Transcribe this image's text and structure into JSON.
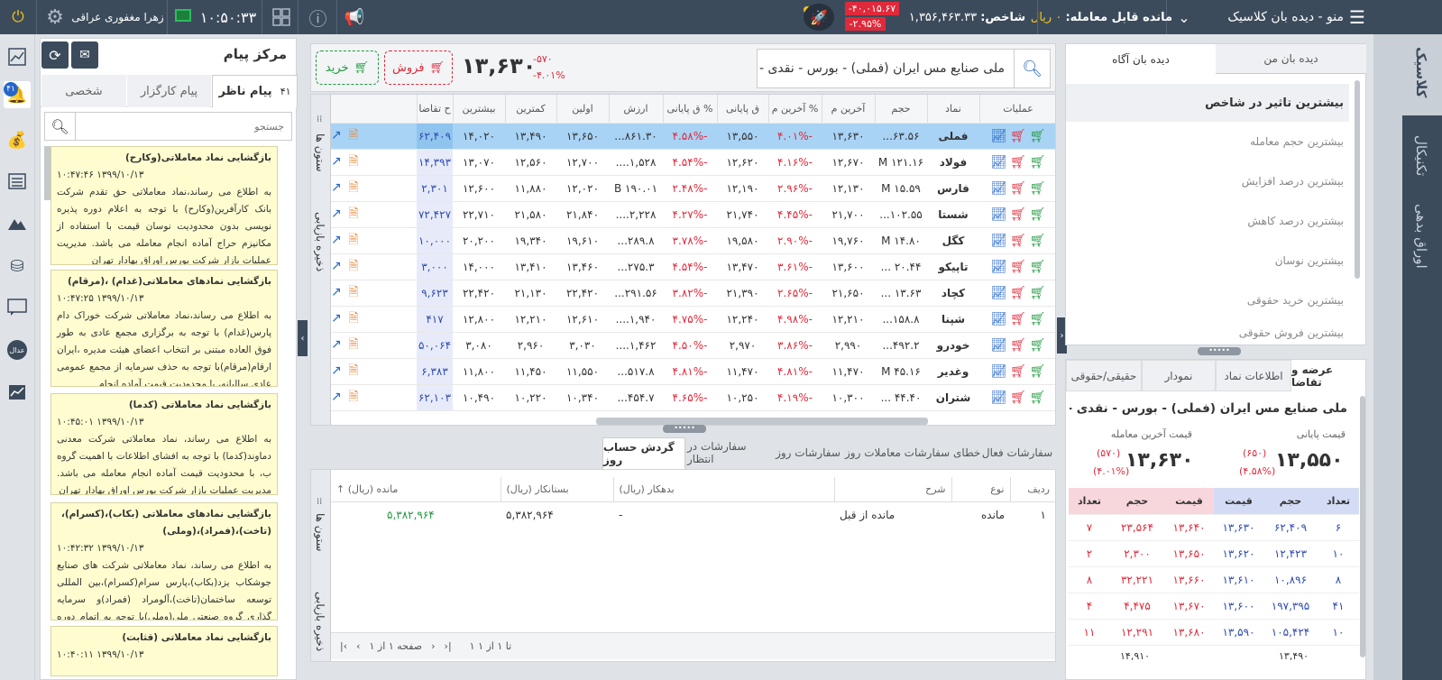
{
  "topbar": {
    "menu_label": "منو - دیده بان کلاسیک",
    "balance_label": "مانده قابل معامله:",
    "balance_value": "۰ ریال",
    "index_label": "شاخص:",
    "index_value": "۱,۳۵۶,۴۶۳.۳۳",
    "index_change": "-۴۰,۰۱۵.۶۷",
    "index_percent": "-۲.۹۵%",
    "clock": "۱۰:۵۰:۳۳",
    "user_name": "زهرا مغفوری عراقی"
  },
  "right_vertical_tabs": [
    "کلاسیک",
    "تکنیکال",
    "اوراق بدهی"
  ],
  "message_center": {
    "title": "مرکز پیام",
    "tabs": [
      "پیام ناظر",
      "پیام کارگزار",
      "شخصی"
    ],
    "badge": "۴۱",
    "search_placeholder": "جستجو",
    "messages": [
      {
        "title": "بازگشایی نماد معاملاتی(وکارح)",
        "time": "۱۳۹۹/۱۰/۱۳ ۱۰:۴۷:۴۶",
        "body": "به اطلاع می رساند،نماد معاملاتی حق تقدم شرکت بانک کارآفرین(وکارح) با توجه به اعلام دوره پذیره نویسی بدون محدودیت نوسان قیمت با استفاده از مکانیزم حراج آماده انجام معامله می باشد. مدیریت عملیات بازار شرکت بورس اوراق بهادار تهران"
      },
      {
        "title": "بازگشایی نمادهای معاملاتی(غدام) ،(مرقام)",
        "time": "۱۳۹۹/۱۰/۱۳ ۱۰:۴۷:۲۵",
        "body": "به اطلاع می رساند،نماد معاملاتی شرکت خوراک دام پارس(غدام) با توجه به برگزاری مجمع عادی به طور فوق العاده مبتنی بر انتخاب اعضای هیئت مدیره ،ایران ارقام(مرقام)با توجه به حذف سرمایه از مجمع عمومی عادی سالیانه، با محدودیت قیمت آماده انجام"
      },
      {
        "title": "بازگشایی نماد معاملاتی (کدما)",
        "time": "۱۳۹۹/۱۰/۱۳ ۱۰:۴۵:۰۱",
        "body": "به اطلاع می رساند، نماد معاملاتی شرکت معدنی دماوند(کدما) با توجه به افشای اطلاعات با اهمیت گروه ب، با محدودیت قیمت آماده انجام معامله می باشد. مدیریت عملیات بازار شرکت بورس اوراق بهادار تهران"
      },
      {
        "title": "بازگشایی نمادهای معاملاتی (بکاب)،(کسرام)،(تاخت)،(فمراد)،(وملی)",
        "time": "۱۳۹۹/۱۰/۱۳ ۱۰:۴۲:۳۲",
        "body": "به اطلاع می رساند، نماد معاملاتی شرکت های صنایع جوشکاب یزد(بکاب)،پارس سرام(کسرام)،بین المللی توسعه ساختمان(تاخت)،آلومراد (فمراد)و سرمایه گذاری گروه صنعتی ملی(وملی)با توجه به اتمام دوره توقف مربوط به"
      },
      {
        "title": "بازگشایی نماد معاملاتی (قثابت)",
        "time": "۱۳۹۹/۱۰/۱۳ ۱۰:۴۰:۱۱",
        "body": ""
      }
    ]
  },
  "order_bar": {
    "buy_label": "خرید",
    "sell_label": "فروش",
    "price": "۱۳,۶۳۰",
    "change": "-۵۷۰",
    "change_percent": "-۴.۰۱%",
    "symbol_search": "ملی صنایع مس ایران (فملی) - بورس - نقدی - مجاز"
  },
  "watch": {
    "side_columns": "ستون ها",
    "side_save": "ذخیره بازیابی",
    "headers": [
      "عملیات",
      "نماد",
      "حجم",
      "آخرین م",
      "% آخرین م",
      "ق پایانی",
      "% ق پایانی",
      "ارزش",
      "اولین",
      "کمترین",
      "بیشترین",
      "ح تقاضا"
    ],
    "rows": [
      {
        "s": "فملی",
        "v": "۶۳.۵۶...",
        "l": "۱۳,۶۳۰",
        "lp": "-۴.۰۱%",
        "c": "۱۳,۵۵۰",
        "cp": "-۴.۵۸%",
        "val": "۸۶۱.۳۰...",
        "f": "۱۳,۶۵۰",
        "mn": "۱۳,۴۹۰",
        "mx": "۱۴,۰۲۰",
        "d": "۶۲,۴۰۹"
      },
      {
        "s": "فولاد",
        "v": "۱۲۱.۱۶ M",
        "l": "۱۲,۶۷۰",
        "lp": "-۴.۱۶%",
        "c": "۱۲,۶۲۰",
        "cp": "-۴.۵۴%",
        "val": "۱,۵۲۸....",
        "f": "۱۲,۷۰۰",
        "mn": "۱۲,۵۶۰",
        "mx": "۱۳,۰۷۰",
        "d": "۱۴,۳۹۳"
      },
      {
        "s": "فارس",
        "v": "۱۵.۵۹ M",
        "l": "۱۲,۱۳۰",
        "lp": "-۲.۹۶%",
        "c": "۱۲,۱۹۰",
        "cp": "-۲.۴۸%",
        "val": "۱۹۰.۰۱ B",
        "f": "۱۲,۰۲۰",
        "mn": "۱۱,۸۸۰",
        "mx": "۱۲,۶۰۰",
        "d": "۲,۳۰۱"
      },
      {
        "s": "شستا",
        "v": "۱۰۲.۵۵...",
        "l": "۲۱,۷۰۰",
        "lp": "-۴.۴۵%",
        "c": "۲۱,۷۴۰",
        "cp": "-۴.۲۷%",
        "val": "۲,۲۲۸....",
        "f": "۲۱,۸۴۰",
        "mn": "۲۱,۵۸۰",
        "mx": "۲۲,۷۱۰",
        "d": "۷۲,۴۲۷"
      },
      {
        "s": "کگل",
        "v": "۱۴.۸۰ M",
        "l": "۱۹,۷۶۰",
        "lp": "-۲.۹۰%",
        "c": "۱۹,۵۸۰",
        "cp": "-۳.۷۸%",
        "val": "۲۸۹.۸...",
        "f": "۱۹,۶۱۰",
        "mn": "۱۹,۳۴۰",
        "mx": "۲۰,۲۰۰",
        "d": "۱۰,۰۰۰"
      },
      {
        "s": "تاپیکو",
        "v": "۲۰.۴۴ ...",
        "l": "۱۳,۶۰۰",
        "lp": "-۳.۶۱%",
        "c": "۱۳,۴۷۰",
        "cp": "-۴.۵۴%",
        "val": "۲۷۵.۳...",
        "f": "۱۳,۴۶۰",
        "mn": "۱۳,۴۱۰",
        "mx": "۱۴,۰۰۰",
        "d": "۳,۰۰۰"
      },
      {
        "s": "کچاد",
        "v": "۱۳.۶۳ ...",
        "l": "۲۱,۶۵۰",
        "lp": "-۲.۶۵%",
        "c": "۲۱,۳۹۰",
        "cp": "-۳.۸۲%",
        "val": "۲۹۱.۵۶...",
        "f": "۲۲,۴۲۰",
        "mn": "۲۱,۱۳۰",
        "mx": "۲۲,۴۲۰",
        "d": "۹,۶۲۳"
      },
      {
        "s": "شپنا",
        "v": "۱۵۸.۸...",
        "l": "۱۲,۲۱۰",
        "lp": "-۴.۹۸%",
        "c": "۱۲,۲۴۰",
        "cp": "-۴.۷۵%",
        "val": "۱,۹۴۰....",
        "f": "۱۲,۶۱۰",
        "mn": "۱۲,۲۱۰",
        "mx": "۱۲,۸۰۰",
        "d": "۴۱۷"
      },
      {
        "s": "خودرو",
        "v": "۴۹۲.۲...",
        "l": "۲,۹۹۰",
        "lp": "-۳.۸۶%",
        "c": "۲,۹۷۰",
        "cp": "-۴.۵۰%",
        "val": "۱,۴۶۲....",
        "f": "۳,۰۳۰",
        "mn": "۲,۹۶۰",
        "mx": "۳,۰۸۰",
        "d": "۵۰,۰۶۴"
      },
      {
        "s": "وغدیر",
        "v": "۴۵.۱۶ M",
        "l": "۱۱,۴۷۰",
        "lp": "-۴.۸۱%",
        "c": "۱۱,۴۷۰",
        "cp": "-۴.۸۱%",
        "val": "۵۱۷.۸...",
        "f": "۱۱,۵۵۰",
        "mn": "۱۱,۴۵۰",
        "mx": "۱۱,۸۰۰",
        "d": "۶,۳۸۳"
      },
      {
        "s": "شتران",
        "v": "۴۴.۴۰ ...",
        "l": "۱۰,۳۰۰",
        "lp": "-۴.۱۹%",
        "c": "۱۰,۲۵۰",
        "cp": "-۴.۶۵%",
        "val": "۴۵۴.۷...",
        "f": "۱۰,۳۴۰",
        "mn": "۱۰,۲۲۰",
        "mx": "۱۰,۴۹۰",
        "d": "۶۲,۱۰۳"
      }
    ]
  },
  "bottom": {
    "tabs": [
      "سفارشات فعال",
      "خطای سفارشات",
      "معاملات روز",
      "سفارشات روز",
      "سفارشات در انتظار",
      "گردش حساب روز"
    ],
    "headers": [
      "ردیف",
      "نوع",
      "شرح",
      "بدهکار (ریال)",
      "بستانکار (ریال)",
      "مانده (ریال)"
    ],
    "row": {
      "idx": "۱",
      "type": "مانده",
      "desc": "مانده از قبل",
      "debit": "-",
      "credit": "۵,۳۸۲,۹۶۴",
      "balance": "۵,۳۸۲,۹۶۴"
    },
    "pager_range": "۱ تا ۱ از ۱",
    "pager_page": "صفحه ۱ از ۱"
  },
  "watch_tabs": [
    "دیده بان من",
    "دیده بان آگاه"
  ],
  "watch_filters": [
    "بیشترین تاثیر در شاخص",
    "بیشترین حجم معامله",
    "بیشترین درصد افزایش",
    "بیشترین درصد کاهش",
    "بیشترین نوسان",
    "بیشترین خرید حقوقی",
    "بیشترین فروش حقوقی"
  ],
  "quote": {
    "tabs": [
      "عرضه و تقاضا",
      "اطلاعات نماد",
      "نمودار",
      "حقیقی/حقوقی"
    ],
    "title": "ملی صنایع مس ایران (فملی) - بورس - نقدی - مجاز",
    "close_label": "قیمت پایانی",
    "last_label": "قیمت آخرین معامله",
    "close_price": "۱۳,۵۵۰",
    "close_change": "(۶۵۰)",
    "close_percent": "(۴.۵۸%)",
    "last_price": "۱۳,۶۳۰",
    "last_change": "(۵۷۰)",
    "last_percent": "(۴.۰۱%)",
    "ob_headers": [
      "تعداد",
      "حجم",
      "قیمت",
      "قیمت",
      "حجم",
      "تعداد"
    ],
    "ob_rows": [
      [
        "۶",
        "۶۲,۴۰۹",
        "۱۳,۶۳۰",
        "۱۳,۶۴۰",
        "۲۳,۵۶۴",
        "۷"
      ],
      [
        "۱۰",
        "۱۲,۴۲۳",
        "۱۳,۶۲۰",
        "۱۳,۶۵۰",
        "۲,۳۰۰",
        "۲"
      ],
      [
        "۸",
        "۱۰,۸۹۶",
        "۱۳,۶۱۰",
        "۱۳,۶۶۰",
        "۳۲,۲۲۱",
        "۸"
      ],
      [
        "۴۱",
        "۱۹۷,۳۹۵",
        "۱۳,۶۰۰",
        "۱۳,۶۷۰",
        "۴,۴۷۵",
        "۴"
      ],
      [
        "۱۰",
        "۱۰۵,۴۲۴",
        "۱۳,۵۹۰",
        "۱۳,۶۸۰",
        "۱۲,۲۹۱",
        "۱۱"
      ]
    ],
    "range_low": "۱۳,۴۹۰",
    "range_high": "۱۴,۹۱۰"
  },
  "colors": {
    "topbar": "#3c4b5c",
    "buy": "#1e9b3e",
    "sell": "#e0293a",
    "highlight": "#a8d3f5",
    "msg_bg": "#fffdd0"
  }
}
